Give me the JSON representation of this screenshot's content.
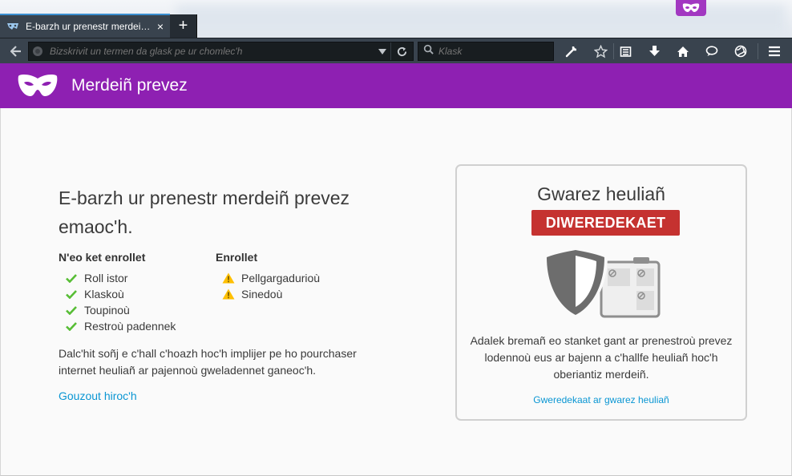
{
  "browser": {
    "tab": {
      "title": "E-barzh ur prenestr merdei…",
      "close": "×"
    },
    "new_tab": "+",
    "url_placeholder": "Bizskrivit un termen da glask pe ur chomlec'h",
    "search_placeholder": "Klask"
  },
  "header": {
    "title": "Merdeiñ prevez"
  },
  "main": {
    "heading": "E-barzh ur prenestr merdeiñ prevez emaoc'h.",
    "not_saved": {
      "title": "N'eo ket enrollet",
      "items": [
        "Roll istor",
        "Klaskoù",
        "Toupinoù",
        "Restroù padennek"
      ]
    },
    "saved": {
      "title": "Enrollet",
      "items": [
        "Pellgargadurioù",
        "Sinedoù"
      ]
    },
    "note": "Dalc'hit soñj e c'hall c'hoazh hoc'h implijer pe ho pourchaser internet heuliañ ar pajennoù gweladennet ganeoc'h.",
    "learn_more": "Gouzout hiroc'h"
  },
  "tracking": {
    "title": "Gwarez heuliañ",
    "status": "DIWEREDEKAET",
    "description": "Adalek bremañ eo stanket gant ar prenestroù prevez lodennoù eus ar bajenn a c'hallfe heuliañ hoc'h oberiantiz merdeiñ.",
    "enable_link": "Gweredekaat ar gwarez heuliañ"
  },
  "colors": {
    "accent_purple": "#8e20b2",
    "check_green": "#57bd35",
    "warning_yellow": "#ffbf00",
    "status_red": "#c53230",
    "link_blue": "#0a96d3"
  }
}
